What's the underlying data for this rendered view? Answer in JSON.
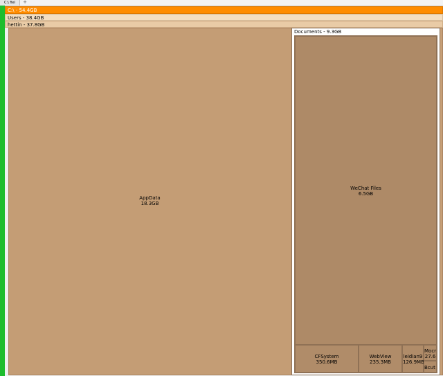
{
  "tabs": [
    {
      "label": "C:\\ fiel"
    }
  ],
  "tab_add_glyph": "+",
  "tree": {
    "drive": "C:\\ - 54.4GB",
    "users": "Users - 38.4GB",
    "user": "hettin - 37.8GB",
    "appdata": {
      "name": "AppData",
      "size": "18.3GB"
    },
    "documents": {
      "header": "Documents - 9.3GB",
      "wechat": {
        "name": "WeChat Files",
        "size": "6.5GB"
      },
      "cfsystem": {
        "name": "CFSystem",
        "size": "350.6MB"
      },
      "webview": {
        "name": "WebView",
        "size": "235.3MB"
      },
      "leidian": {
        "name": "leidian9",
        "size": "126.9MB"
      },
      "mocr": {
        "name": "Mocr",
        "size": "27.6"
      },
      "bcut": {
        "name": "Bcut"
      }
    }
  },
  "colors": {
    "drive": "#ff8c00",
    "users": "#f4dec1",
    "user": "#e9cba6",
    "folder": "#c49d75",
    "documents_inner": "#b18d6a",
    "accent_green": "#1ebd2e"
  }
}
